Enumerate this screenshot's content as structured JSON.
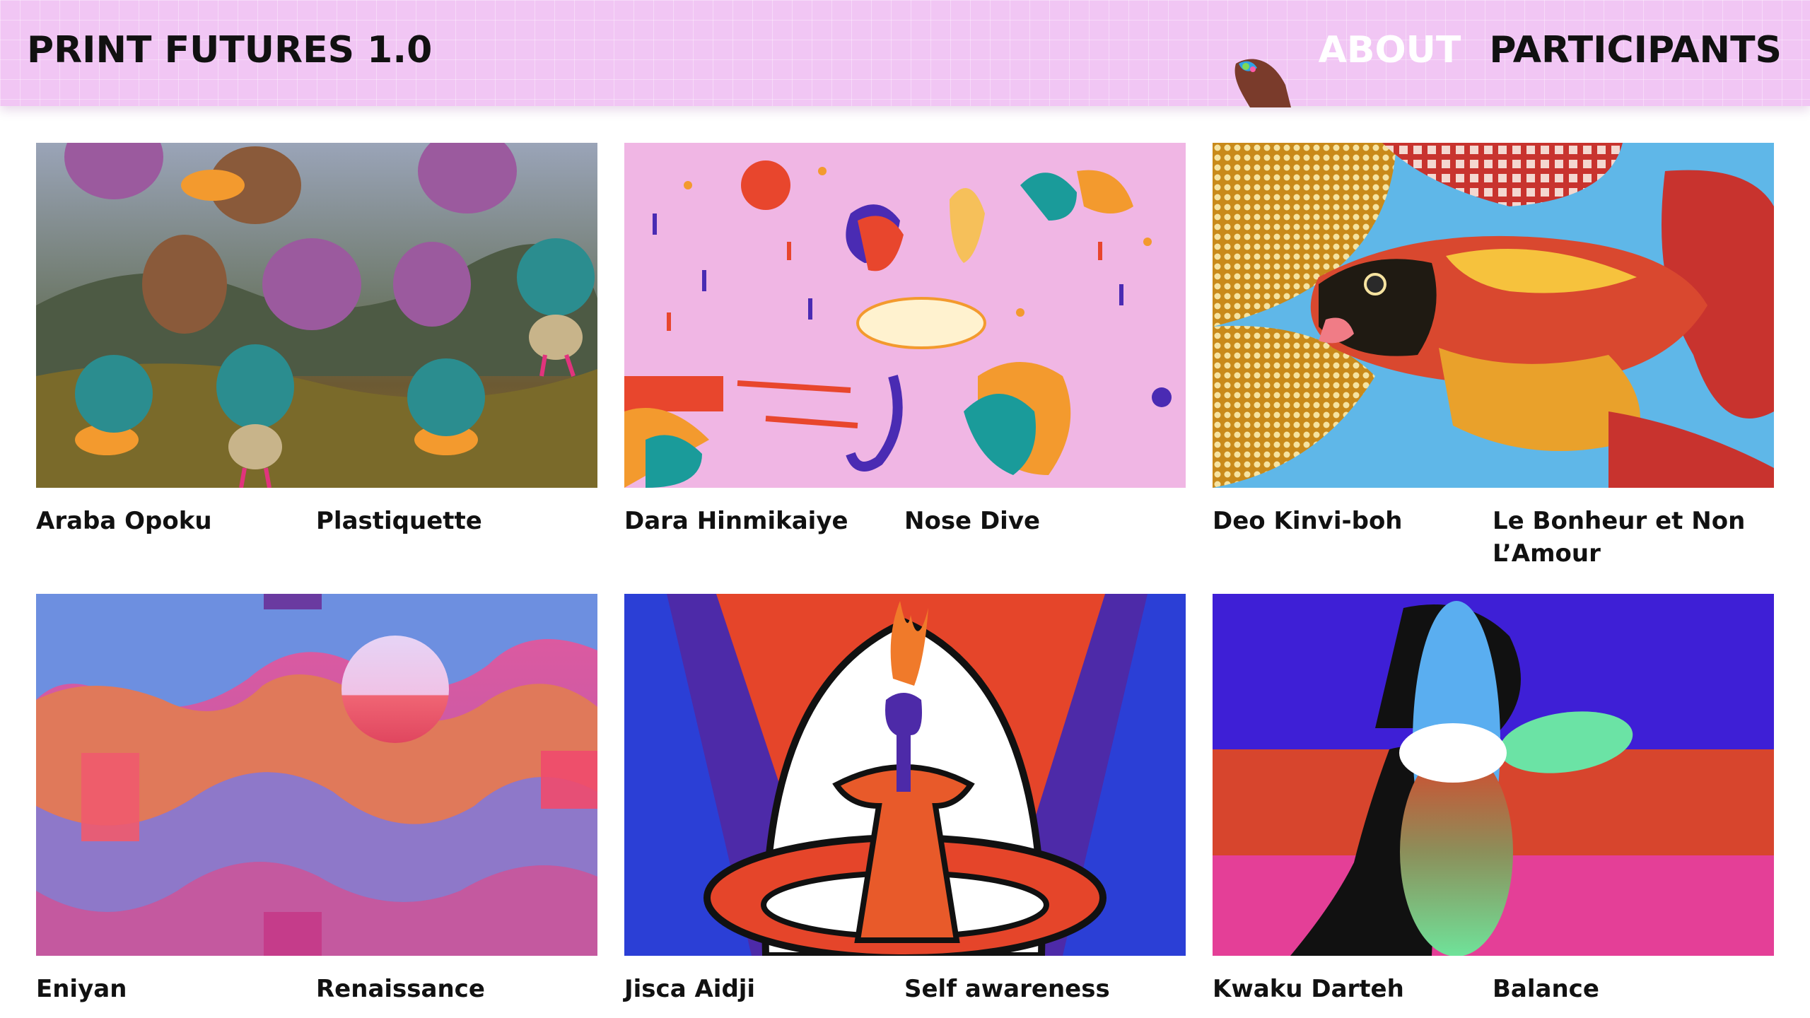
{
  "header": {
    "site_title": "PRINT FUTURES 1.0",
    "nav": [
      {
        "label": "ABOUT"
      },
      {
        "label": "PARTICIPANTS"
      }
    ]
  },
  "colors": {
    "header_bg": "#f1c6f4",
    "nav_about": "#ffffff",
    "text": "#111111"
  },
  "gallery": [
    {
      "artist": "Araba Opoku",
      "title": "Plastiquette"
    },
    {
      "artist": "Dara Hinmikaiye",
      "title": "Nose Dive"
    },
    {
      "artist": "Deo Kinvi-boh",
      "title": "Le Bonheur et Non L’Amour"
    },
    {
      "artist": "Eniyan",
      "title": "Renaissance"
    },
    {
      "artist": "Jisca Aidji",
      "title": "Self awareness"
    },
    {
      "artist": "Kwaku Darteh",
      "title": "Balance"
    }
  ]
}
